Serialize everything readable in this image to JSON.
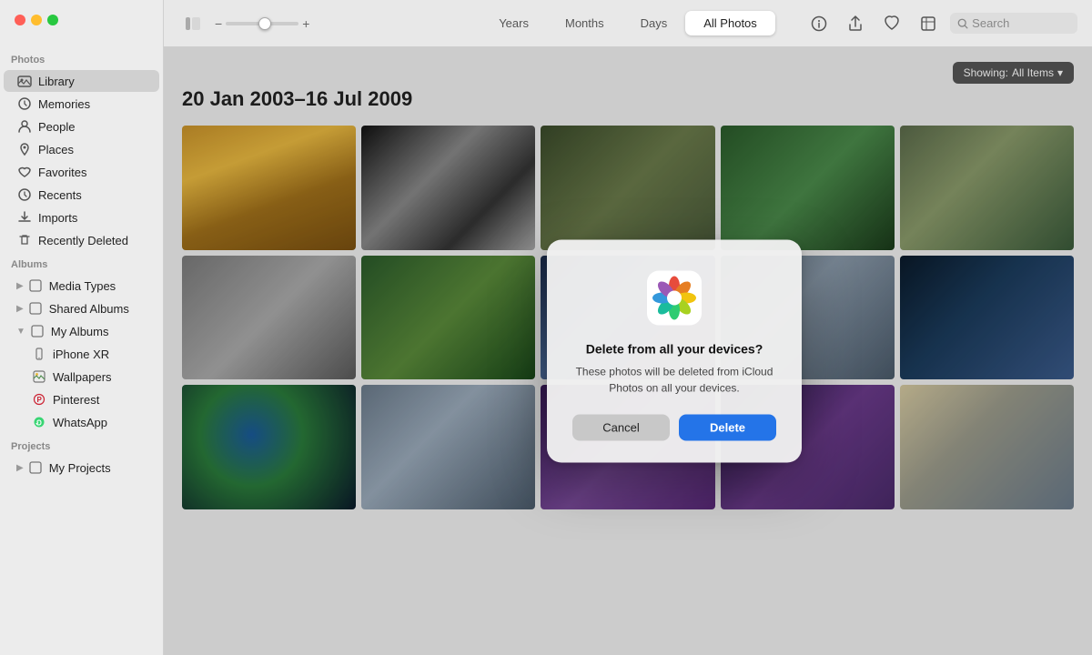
{
  "window": {
    "title": "Photos"
  },
  "sidebar": {
    "sections": [
      {
        "label": "Photos",
        "items": [
          {
            "id": "library",
            "label": "Library",
            "icon": "📷",
            "active": true
          },
          {
            "id": "memories",
            "label": "Memories",
            "icon": "🕐"
          },
          {
            "id": "people",
            "label": "People",
            "icon": "👤"
          },
          {
            "id": "places",
            "label": "Places",
            "icon": "📍"
          },
          {
            "id": "favorites",
            "label": "Favorites",
            "icon": "❤️"
          },
          {
            "id": "recents",
            "label": "Recents",
            "icon": "🕒"
          },
          {
            "id": "imports",
            "label": "Imports",
            "icon": "📥"
          },
          {
            "id": "recently-deleted",
            "label": "Recently Deleted",
            "icon": "🗑️"
          }
        ]
      },
      {
        "label": "Albums",
        "items": [
          {
            "id": "media-types",
            "label": "Media Types",
            "icon": "📁",
            "expandable": true
          },
          {
            "id": "shared-albums",
            "label": "Shared Albums",
            "icon": "📁",
            "expandable": true
          },
          {
            "id": "my-albums",
            "label": "My Albums",
            "icon": "📁",
            "expanded": true,
            "expandable": true
          }
        ],
        "subItems": [
          {
            "id": "iphone-xr",
            "label": "iPhone XR",
            "icon": "📱"
          },
          {
            "id": "wallpapers",
            "label": "Wallpapers",
            "icon": "🖼️"
          },
          {
            "id": "pinterest",
            "label": "Pinterest",
            "icon": "📌"
          },
          {
            "id": "whatsapp",
            "label": "WhatsApp",
            "icon": "💬"
          }
        ]
      },
      {
        "label": "Projects",
        "items": [
          {
            "id": "my-projects",
            "label": "My Projects",
            "icon": "📁",
            "expandable": true
          }
        ]
      }
    ]
  },
  "toolbar": {
    "view_icon": "⊞",
    "slider_min": "−",
    "slider_max": "+",
    "tabs": [
      {
        "id": "years",
        "label": "Years"
      },
      {
        "id": "months",
        "label": "Months"
      },
      {
        "id": "days",
        "label": "Days"
      },
      {
        "id": "all-photos",
        "label": "All Photos",
        "active": true
      }
    ],
    "info_icon": "ℹ",
    "share_icon": "↑",
    "heart_icon": "♡",
    "frame_icon": "⬜",
    "search_placeholder": "Search"
  },
  "content": {
    "showing_label": "Showing:",
    "showing_value": "All Items",
    "showing_chevron": "▾",
    "date_range": "20 Jan 2003–16 Jul 2009"
  },
  "dialog": {
    "title": "Delete from all your devices?",
    "message": "These photos will be deleted from iCloud Photos on all your devices.",
    "cancel_label": "Cancel",
    "delete_label": "Delete"
  }
}
